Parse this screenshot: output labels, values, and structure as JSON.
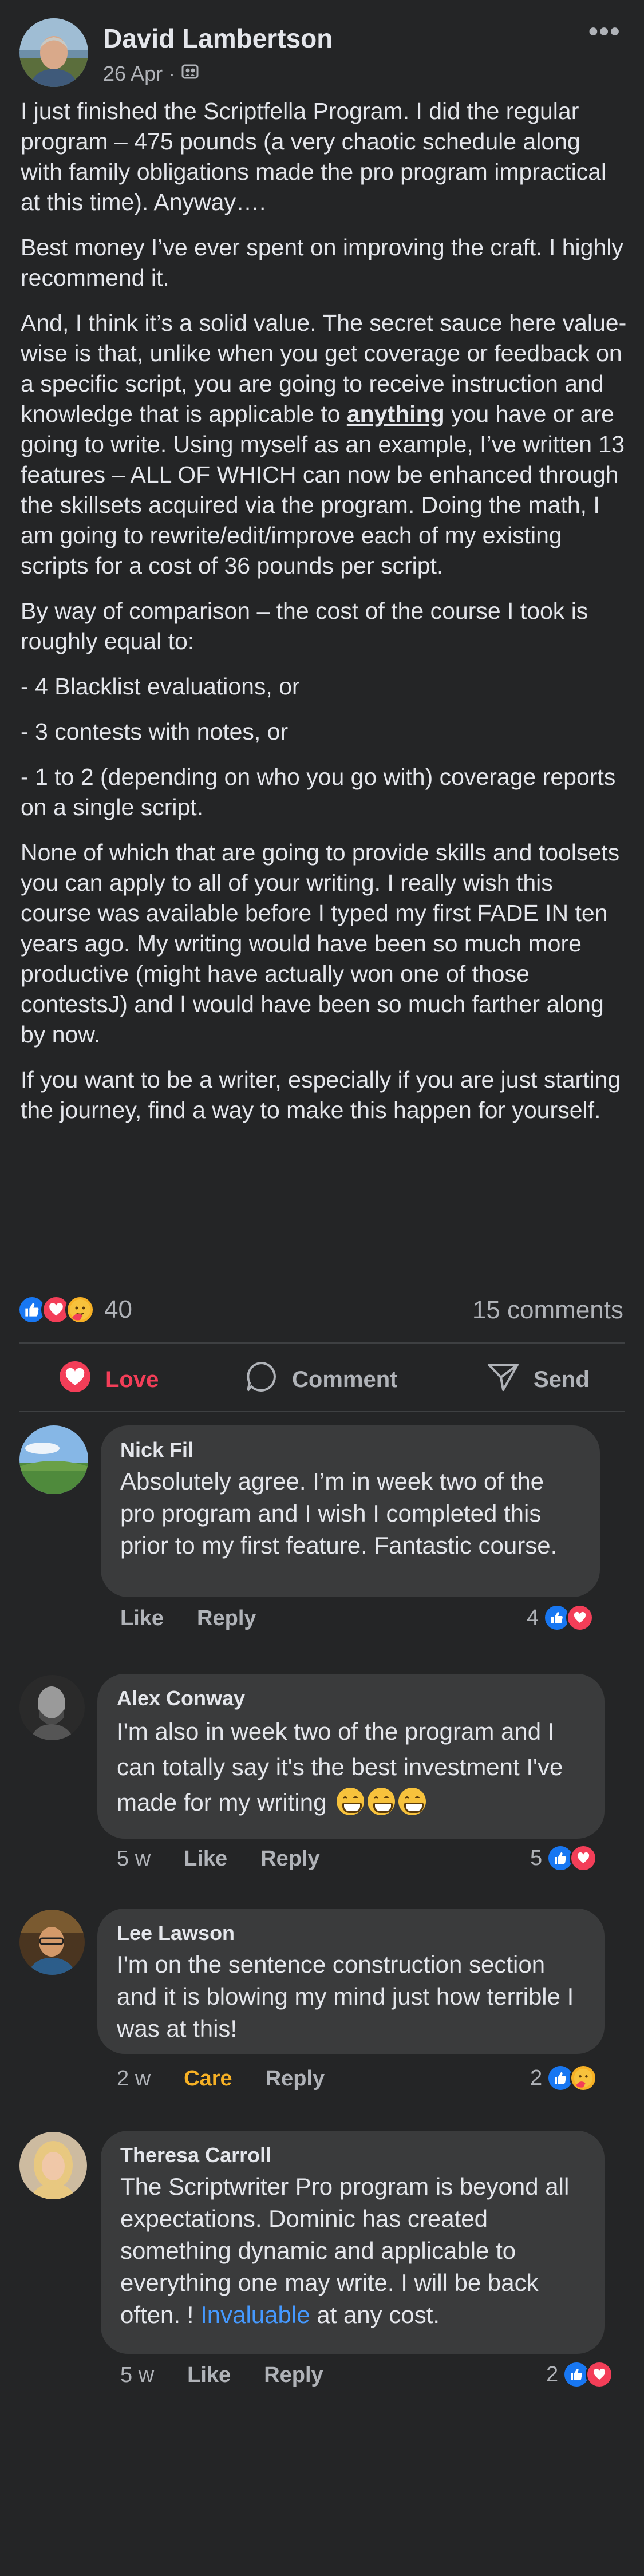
{
  "post": {
    "author": "David Lambertson",
    "date": "26 Apr",
    "meta_separator": "·",
    "privacy_icon": "friends-icon",
    "more_icon": "more-options-icon",
    "more_label": "•••",
    "paragraphs": {
      "p1": "I just finished the Scriptfella Program.  I did the regular program – 475 pounds (a very chaotic schedule along with family obligations made the pro program impractical at this time). Anyway….",
      "p2": "Best money I’ve ever spent on improving the craft. I highly recommend it.",
      "p3_before": "And, I think it’s a solid value. The secret sauce here value-wise is that, unlike when you get coverage or feedback on a specific script, you are going to receive instruction and knowledge that is applicable to ",
      "p3_emph": "anything",
      "p3_after": " you have or are going to write. Using myself as an example, I’ve written 13 features – ALL OF WHICH can now be enhanced through the skillsets acquired via the program.  Doing the math,  I am going to rewrite/edit/improve each of my existing scripts for a cost of 36 pounds per script.",
      "p4": "By way of comparison – the cost of the course I took is roughly equal to:",
      "p5": "- 4 Blacklist evaluations, or",
      "p6": "- 3 contests with notes, or",
      "p7": "- 1 to 2 (depending on who you go with) coverage reports on a single script.",
      "p8": "None of which that are going to provide skills and toolsets you can apply to all of your writing. I really wish this course was available before I typed my first FADE IN ten years ago. My writing would have been so much more productive (might have actually won one of those contestsJ) and I would have been so much farther along by now.",
      "p9": "If you want to be a writer, especially if you are just starting the journey, find a way to make this happen for yourself."
    },
    "reaction_count": "40",
    "comment_count": "15 comments"
  },
  "actions": {
    "love": "Love",
    "comment": "Comment",
    "send": "Send"
  },
  "comments": [
    {
      "name": "Nick Fil",
      "text": "Absolutely agree. I’m in week two of the pro program and I wish I completed this prior to my first feature. Fantastic course.",
      "time": "",
      "reaction_label": "Like",
      "reply": "Reply",
      "count": "4"
    },
    {
      "name": "Alex Conway",
      "text": "I'm also in week two of the program and I can totally say it's the best investment I've made for my writing",
      "time": "5 w",
      "reaction_label": "Like",
      "reply": "Reply",
      "count": "5"
    },
    {
      "name": "Lee Lawson",
      "text": "I'm on the sentence construction section and it is blowing my mind just how terrible I was at this!",
      "time": "2 w",
      "reaction_label": "Care",
      "reply": "Reply",
      "count": "2"
    },
    {
      "name": "Theresa Carroll",
      "text_before": "The Scriptwriter Pro program is beyond all expectations. Dominic has created something dynamic and applicable to everything one may write. I will be back often. ! ",
      "text_link": "Invaluable",
      "text_after": " at any cost.",
      "time": "5 w",
      "reaction_label": "Like",
      "reply": "Reply",
      "count": "2"
    }
  ],
  "colors": {
    "background": "#242526",
    "bubble": "#3a3b3c",
    "like_blue": "#1877f2",
    "love_red": "#f33e58",
    "care_yellow": "#f7b125",
    "link_blue": "#4599ff"
  }
}
